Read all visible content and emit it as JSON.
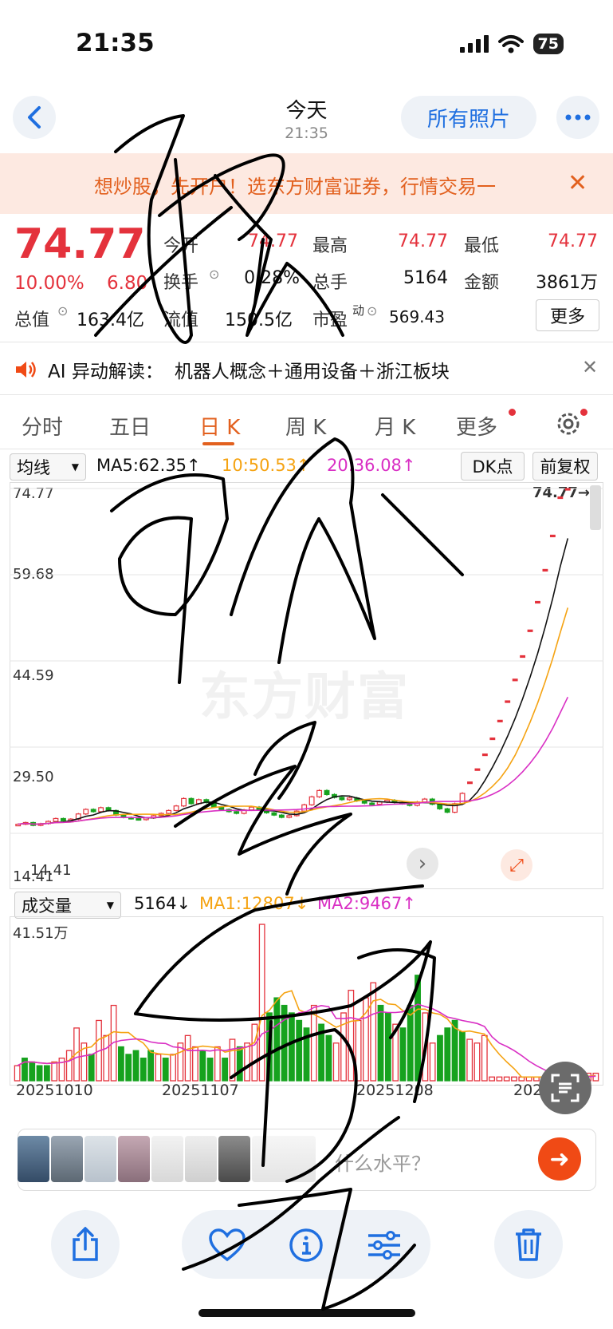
{
  "status_bar": {
    "time": "21:35",
    "battery": "75"
  },
  "nav": {
    "title": "今天",
    "subtitle": "21:35",
    "photos_button": "所有照片"
  },
  "ad": {
    "text": "想炒股，先开户！选东方财富证券，行情交易一"
  },
  "quote": {
    "price": "74.77",
    "change_pct": "10.00%",
    "change": "6.80",
    "open_label": "今开",
    "open": "74.77",
    "high_label": "最高",
    "high": "74.77",
    "low_label": "最低",
    "low": "74.77",
    "turnover_label": "换手",
    "turnover": "0.28%",
    "volume_label": "总手",
    "volume": "5164",
    "amount_label": "金额",
    "amount": "3861万",
    "mktcap_label": "总值",
    "mktcap": "163.4亿",
    "float_label": "流值",
    "float_cap": "150.5亿",
    "pe_label": "市盈",
    "pe_sup": "动",
    "pe": "569.43",
    "more_button": "更多"
  },
  "ai_row": {
    "label": "AI 异动解读：",
    "text": "机器人概念＋通用设备＋浙江板块"
  },
  "tabs": {
    "intraday": "分时",
    "five_day": "五日",
    "daily": "日 K",
    "weekly": "周 K",
    "monthly": "月 K",
    "more": "更多"
  },
  "chart_header": {
    "ma_select": "均线",
    "ma5": "MA5:62.35↑",
    "ma10": "10:50.53↑",
    "ma20": "20:36.08↑",
    "dk_button": "DK点",
    "adjust_button": "前复权"
  },
  "vol_header": {
    "select": "成交量",
    "vol": "5164↓",
    "ma1": "MA1:12807↓",
    "ma2": "MA2:9467↑"
  },
  "composer": {
    "placeholder": "什么水平？"
  },
  "colors": {
    "up": "#e4323c",
    "down": "#16a21e",
    "accent": "#e2601e",
    "ma5": "#111111",
    "ma10": "#f5a312",
    "ma20": "#d92fc4",
    "link": "#1f6fe0"
  },
  "chart_data": [
    {
      "type": "candlestick",
      "y_ticks": [
        "74.77",
        "59.68",
        "44.59",
        "29.50",
        "14.41"
      ],
      "ylim": [
        14.41,
        74.77
      ],
      "last_price_label": "74.77→",
      "min_label": "14.41",
      "closes": [
        16.0,
        16.3,
        15.8,
        16.1,
        16.5,
        17.0,
        16.6,
        16.9,
        17.8,
        18.6,
        18.2,
        18.9,
        18.4,
        17.6,
        17.2,
        17.0,
        16.8,
        17.1,
        17.5,
        17.9,
        18.4,
        19.2,
        20.5,
        19.6,
        20.3,
        19.8,
        19.0,
        18.6,
        18.2,
        17.9,
        18.5,
        19.0,
        18.6,
        18.0,
        17.6,
        17.2,
        17.5,
        18.3,
        19.4,
        20.8,
        21.9,
        21.2,
        20.7,
        20.3,
        20.6,
        20.1,
        19.7,
        19.5,
        19.9,
        20.2,
        19.8,
        19.6,
        19.3,
        19.9,
        20.4,
        19.5,
        18.7,
        18.1,
        19.6,
        21.4,
        23.4,
        25.7,
        28.3,
        31.1,
        34.2,
        37.6,
        41.4,
        45.5,
        50.0,
        55.0,
        60.6,
        66.6,
        73.3,
        74.77
      ],
      "series": [
        {
          "name": "MA5"
        },
        {
          "name": "MA10"
        },
        {
          "name": "MA20"
        }
      ]
    },
    {
      "type": "bar",
      "title": "成交量",
      "y_ticks": [
        "41.51万"
      ],
      "ylim": [
        0,
        41.51
      ],
      "x_ticks": [
        "20251010",
        "20251107",
        "20251208",
        "202"
      ],
      "values": [
        4,
        6,
        5,
        4,
        4,
        5,
        6,
        8,
        14,
        10,
        7,
        16,
        12,
        20,
        9,
        7,
        8,
        6,
        8,
        7,
        6,
        7,
        10,
        12,
        9,
        8,
        6,
        9,
        6,
        11,
        9,
        10,
        15,
        41.5,
        18,
        22,
        20,
        18,
        16,
        14,
        20,
        15,
        12,
        10,
        18,
        24,
        16,
        22,
        26,
        20,
        18,
        15,
        14,
        20,
        28,
        18,
        10,
        12,
        14,
        16,
        13,
        11,
        10,
        12,
        1,
        1,
        1,
        1,
        1,
        1,
        1,
        1,
        1,
        1,
        1,
        1,
        1,
        2,
        2
      ],
      "up_flags": [
        1,
        0,
        0,
        0,
        0,
        1,
        1,
        1,
        1,
        1,
        0,
        1,
        1,
        1,
        0,
        0,
        0,
        0,
        0,
        1,
        0,
        1,
        1,
        1,
        1,
        0,
        0,
        1,
        0,
        1,
        0,
        1,
        1,
        1,
        0,
        0,
        0,
        0,
        0,
        0,
        1,
        0,
        0,
        1,
        1,
        1,
        1,
        1,
        1,
        0,
        0,
        1,
        0,
        0,
        0,
        1,
        1,
        0,
        0,
        0,
        0,
        1,
        1,
        1,
        1,
        1,
        1,
        1,
        1,
        1,
        1,
        1,
        1,
        1,
        1,
        1,
        1,
        1,
        1
      ]
    }
  ]
}
